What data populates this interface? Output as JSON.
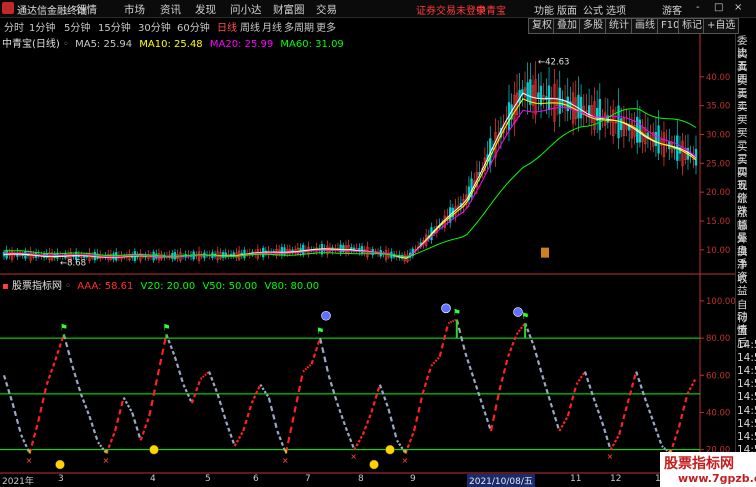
{
  "menubar": {
    "app_title": "通达信金融终端",
    "items": [
      "行情",
      "市场",
      "资讯",
      "发现",
      "问小达",
      "财富圈",
      "交易"
    ],
    "login_notice": "证券交易未登录",
    "stock_name": "中青宝",
    "right_items": [
      "功能",
      "版面",
      "公式",
      "选项"
    ],
    "guest": "游客",
    "window_controls": [
      "-",
      "□",
      "×"
    ]
  },
  "toolbar": {
    "periods": [
      "分时",
      "1分钟",
      "5分钟",
      "15分钟",
      "30分钟",
      "60分钟",
      "日线",
      "周线",
      "月线",
      "多周期",
      "更多"
    ],
    "active_period": "日线",
    "buttons": [
      "复权",
      "叠加",
      "多股",
      "统计",
      "画线",
      "F10",
      "标记",
      "+自选"
    ]
  },
  "main_legend": {
    "title": "中青宝(日线)",
    "ma": [
      {
        "label": "MA5: 25.94",
        "color": "#ffffff"
      },
      {
        "label": "MA10: 25.48",
        "color": "#ffff00"
      },
      {
        "label": "MA20: 25.99",
        "color": "#ff00ff"
      },
      {
        "label": "MA60: 31.09",
        "color": "#00ff00"
      }
    ]
  },
  "indicator_legend": {
    "title": "股票指标网",
    "values": [
      {
        "label": "AAA: 58.61",
        "color": "#ff3030"
      },
      {
        "label": "V20: 20.00",
        "color": "#00ff00"
      },
      {
        "label": "V50: 50.00",
        "color": "#00ff00"
      },
      {
        "label": "V80: 80.00",
        "color": "#00ff00"
      }
    ]
  },
  "side_panel": {
    "items": [
      "委比",
      "卖五",
      "卖四",
      "卖三",
      "卖二",
      "卖一",
      "买一",
      "买二",
      "买三",
      "买四",
      "买五",
      "现价",
      "涨跌",
      "涨幅",
      "总量",
      "外盘",
      "换手",
      "净资",
      "收益",
      "",
      "自动",
      "行情",
      "盘后",
      "14:5",
      "14:5",
      "14:5",
      "14:5",
      "14:5",
      "14:5",
      "14:5",
      "14:5",
      "14:5"
    ]
  },
  "date_axis": {
    "labels": [
      "2021年",
      "3",
      "4",
      "5",
      "6",
      "7",
      "8",
      "9",
      "11",
      "12",
      "1",
      "2"
    ],
    "highlight": "2021/10/08/五"
  },
  "watermark": {
    "line1": "股票指标网",
    "line2": "www.7gpzb.com"
  },
  "chart_data": {
    "type": "line",
    "title": "中青宝(日线)",
    "price_axis": {
      "ticks": [
        10.0,
        15.0,
        20.0,
        25.0,
        30.0,
        35.0,
        40.0
      ],
      "ylim": [
        6.5,
        45
      ]
    },
    "annotations": [
      {
        "label": "42.63",
        "kind": "high"
      },
      {
        "label": "8.68",
        "kind": "low"
      }
    ],
    "x": [
      "2021-02",
      "2021-03",
      "2021-04",
      "2021-05",
      "2021-06",
      "2021-07",
      "2021-08",
      "2021-09",
      "2021-10",
      "2021-11",
      "2021-12",
      "2022-01",
      "2022-02"
    ],
    "series": [
      {
        "name": "MA5",
        "color": "#ffffff",
        "values": [
          9.2,
          8.9,
          8.8,
          8.9,
          9.1,
          9.8,
          10.2,
          8.6,
          18.5,
          37.5,
          34.5,
          30.5,
          25.9
        ]
      },
      {
        "name": "MA10",
        "color": "#ffff00",
        "values": [
          9.3,
          9.0,
          8.8,
          8.9,
          9.1,
          9.7,
          10.1,
          8.7,
          18.0,
          36.5,
          34.0,
          30.8,
          25.5
        ]
      },
      {
        "name": "MA20",
        "color": "#ff00ff",
        "values": [
          9.4,
          9.1,
          8.9,
          8.9,
          9.0,
          9.6,
          10.0,
          8.8,
          17.0,
          34.5,
          34.0,
          32.0,
          26.0
        ]
      },
      {
        "name": "MA60",
        "color": "#00ff00",
        "values": [
          9.8,
          9.4,
          9.1,
          9.0,
          9.0,
          9.2,
          9.5,
          8.9,
          12.5,
          24.5,
          31.5,
          34.5,
          31.1
        ]
      }
    ],
    "indicator": {
      "name": "AAA",
      "axis_ticks": [
        20.0,
        40.0,
        60.0,
        80.0,
        100.0
      ],
      "ylim": [
        8,
        108
      ],
      "reference_lines": [
        {
          "name": "V20",
          "value": 20
        },
        {
          "name": "V50",
          "value": 50
        },
        {
          "name": "V80",
          "value": 80
        }
      ],
      "values": [
        60,
        45,
        28,
        18,
        35,
        55,
        68,
        82,
        65,
        50,
        38,
        24,
        18,
        30,
        48,
        40,
        25,
        38,
        60,
        82,
        70,
        55,
        45,
        58,
        62,
        50,
        35,
        22,
        30,
        45,
        55,
        48,
        30,
        18,
        40,
        62,
        66,
        80,
        60,
        45,
        32,
        20,
        28,
        40,
        55,
        42,
        25,
        18,
        30,
        50,
        65,
        70,
        88,
        90,
        72,
        58,
        44,
        30,
        52,
        70,
        82,
        88,
        76,
        60,
        45,
        30,
        38,
        55,
        62,
        48,
        35,
        20,
        28,
        45,
        62,
        48,
        35,
        22,
        18,
        32,
        50,
        58.61
      ]
    }
  }
}
